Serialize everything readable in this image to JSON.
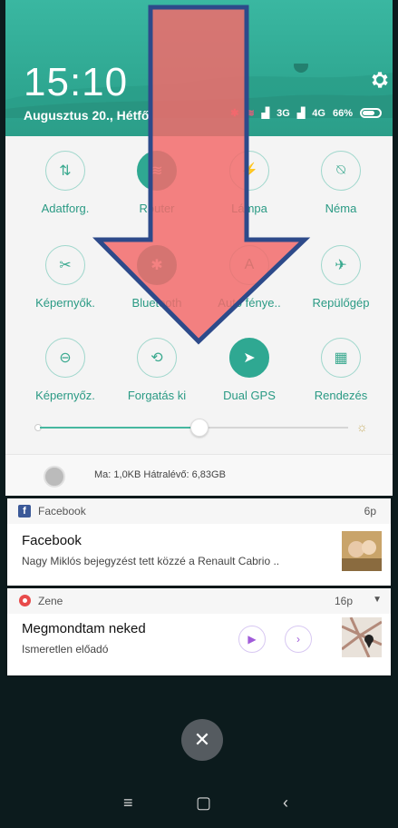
{
  "header": {
    "time": "15:10",
    "date": "Augusztus 20., Hétfő",
    "status": {
      "net1": "3G",
      "net2": "4G",
      "battery": "66%"
    }
  },
  "quick_tiles": [
    {
      "label": "Adatforg.",
      "icon": "data-transfer-icon",
      "on": false
    },
    {
      "label": "Router",
      "icon": "wifi-icon",
      "on": true
    },
    {
      "label": "Lámpa",
      "icon": "flashlight-icon",
      "on": false
    },
    {
      "label": "Néma",
      "icon": "mute-bell-icon",
      "on": false
    },
    {
      "label": "Képernyők.",
      "icon": "screenshot-icon",
      "on": false
    },
    {
      "label": "Bluetooth",
      "icon": "bluetooth-icon",
      "on": true
    },
    {
      "label": "Auto fénye..",
      "icon": "auto-brightness-icon",
      "on": false
    },
    {
      "label": "Repülőgép",
      "icon": "airplane-icon",
      "on": false
    },
    {
      "label": "Képernyőz.",
      "icon": "lock-screen-icon",
      "on": false
    },
    {
      "label": "Forgatás ki",
      "icon": "rotation-lock-icon",
      "on": false
    },
    {
      "label": "Dual GPS",
      "icon": "gps-icon",
      "on": true
    },
    {
      "label": "Rendezés",
      "icon": "grid-icon",
      "on": false
    }
  ],
  "brightness": {
    "level": 0.5
  },
  "storage": {
    "text": "Ma: 1,0KB   Hátralévő: 6,83GB"
  },
  "notifications": {
    "facebook": {
      "app": "Facebook",
      "time": "6p",
      "title": "Facebook",
      "body": "Nagy Miklós bejegyzést tett közzé a Renault Cabrio .."
    },
    "music": {
      "app": "Zene",
      "time": "16p",
      "title": "Megmondtam neked",
      "artist": "Ismeretlen előadó"
    }
  },
  "nav": {
    "menu": "≡",
    "home": "▢",
    "back": "‹"
  },
  "colors": {
    "accent": "#2fa892",
    "arrow_fill": "#f26b6b",
    "arrow_stroke": "#2d4a8a"
  }
}
